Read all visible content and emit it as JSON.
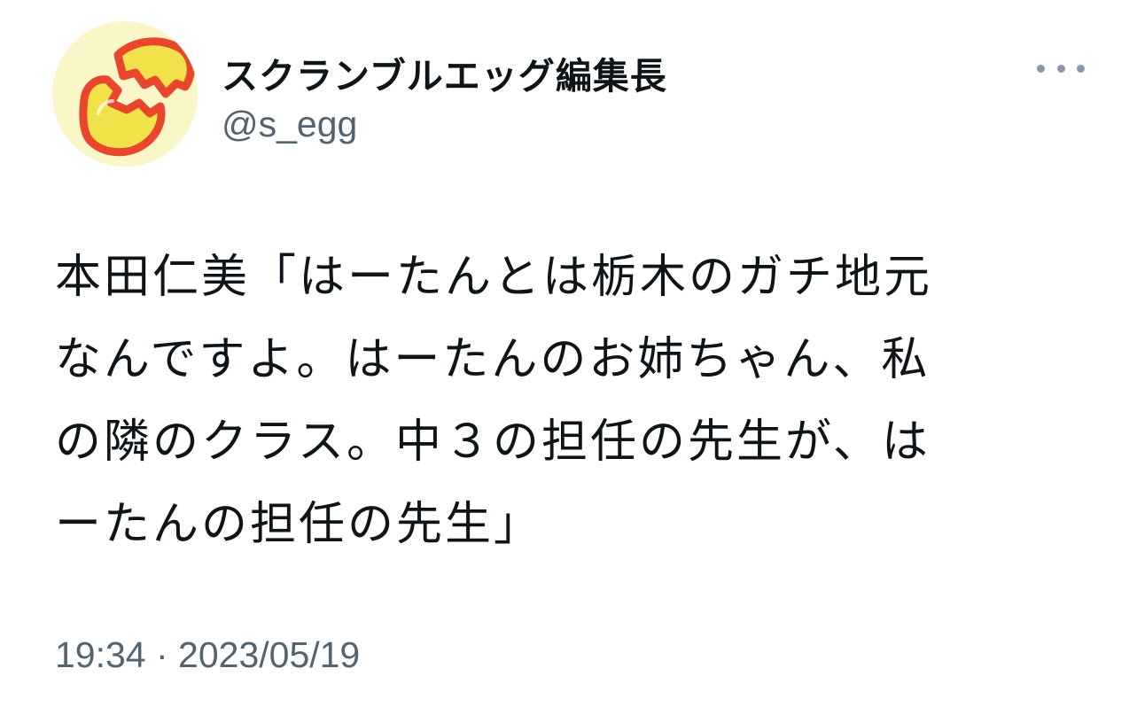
{
  "author": {
    "display_name": "スクランブルエッグ編集長",
    "handle": "@s_egg",
    "avatar_icon": "cracked-egg-icon"
  },
  "menu": {
    "icon": "more-horizontal-icon"
  },
  "tweet": {
    "lines": [
      "本田仁美「はーたんとは栃木のガチ地元",
      "なんですよ。はーたんのお姉ちゃん、私",
      "の隣のクラス。中３の担任の先生が、は",
      "ーたんの担任の先生」"
    ],
    "timestamp": "19:34 · 2023/05/19"
  },
  "colors": {
    "text_primary": "#0f1419",
    "text_secondary": "#536471",
    "avatar_background": "#fbf6c8",
    "egg_fill": "#f2e24a",
    "egg_outline": "#e8472d"
  }
}
